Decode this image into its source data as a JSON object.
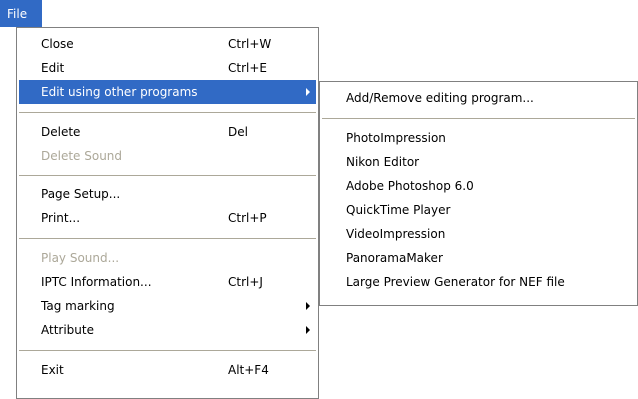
{
  "colors": {
    "highlight": "#316ac5",
    "disabled_text": "#aca899",
    "border": "#808080"
  },
  "menubar": {
    "file": "File"
  },
  "file_menu": {
    "close": {
      "label": "Close",
      "shortcut": "Ctrl+W"
    },
    "edit": {
      "label": "Edit",
      "shortcut": "Ctrl+E"
    },
    "edit_using": {
      "label": "Edit using other programs"
    },
    "delete": {
      "label": "Delete",
      "shortcut": "Del"
    },
    "delete_sound": {
      "label": "Delete Sound"
    },
    "page_setup": {
      "label": "Page Setup..."
    },
    "print": {
      "label": "Print...",
      "shortcut": "Ctrl+P"
    },
    "play_sound": {
      "label": "Play Sound..."
    },
    "iptc": {
      "label": "IPTC Information...",
      "shortcut": "Ctrl+J"
    },
    "tag_marking": {
      "label": "Tag marking"
    },
    "attribute": {
      "label": "Attribute"
    },
    "exit": {
      "label": "Exit",
      "shortcut": "Alt+F4"
    }
  },
  "submenu": {
    "add_remove": "Add/Remove editing program...",
    "programs": [
      "PhotoImpression",
      "Nikon Editor",
      "Adobe Photoshop 6.0",
      "QuickTime Player",
      "VideoImpression",
      "PanoramaMaker",
      "Large Preview Generator for NEF file"
    ]
  }
}
